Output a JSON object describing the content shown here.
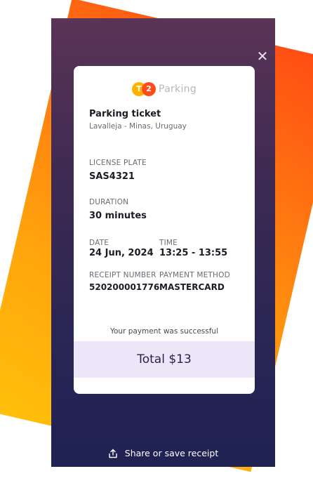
{
  "modal": {
    "close_icon": "close-icon"
  },
  "ticket": {
    "brand": {
      "logo_left": "T",
      "logo_right": "2",
      "name": "Parking"
    },
    "title": "Parking ticket",
    "location": "Lavalleja - Minas, Uruguay",
    "license_plate": {
      "label": "LICENSE PLATE",
      "value": "SAS4321"
    },
    "duration": {
      "label": "DURATION",
      "value": "30 minutes"
    },
    "date": {
      "label": "DATE",
      "value": "24 Jun, 2024"
    },
    "time": {
      "label": "TIME",
      "value": "13:25 - 13:55"
    },
    "receipt_number": {
      "label": "RECEIPT NUMBER",
      "value": "520200001776"
    },
    "payment_method": {
      "label": "PAYMENT METHOD",
      "value": "MASTERCARD"
    },
    "status_message": "Your payment was successful",
    "total": "Total $13"
  },
  "footer": {
    "share_label": "Share or save receipt",
    "share_icon": "share-icon"
  },
  "colors": {
    "accent_orange": "#ff4d1a",
    "accent_yellow": "#ffb300",
    "total_bg": "#ede6f8",
    "modal_bg_top": "#5b3457",
    "modal_bg_bottom": "#1f2253"
  }
}
